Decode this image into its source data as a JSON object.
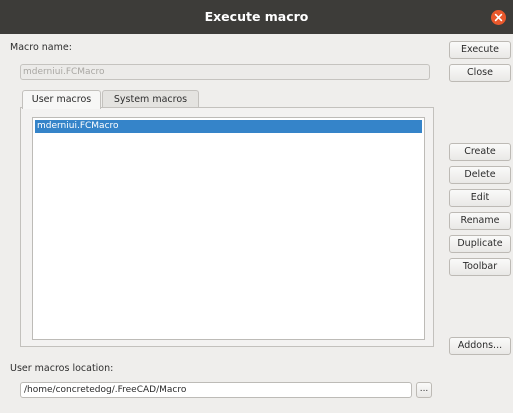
{
  "window": {
    "title": "Execute macro",
    "close_icon": "close-icon",
    "close_color": "#e9582c"
  },
  "macro_name": {
    "label": "Macro name:",
    "value": "mderniui.FCMacro"
  },
  "tabs": [
    {
      "label": "User macros",
      "selected": true
    },
    {
      "label": "System macros",
      "selected": false
    }
  ],
  "macro_list": {
    "items": [
      {
        "label": "mderniui.FCMacro",
        "selected": true
      }
    ],
    "selection_color": "#3584c9"
  },
  "buttons": {
    "execute": "Execute",
    "close": "Close",
    "create": "Create",
    "delete": "Delete",
    "edit": "Edit",
    "rename": "Rename",
    "duplicate": "Duplicate",
    "toolbar": "Toolbar",
    "addons": "Addons..."
  },
  "location": {
    "label": "User macros location:",
    "path": "/home/concretedog/.FreeCAD/Macro",
    "browse_label": "..."
  }
}
